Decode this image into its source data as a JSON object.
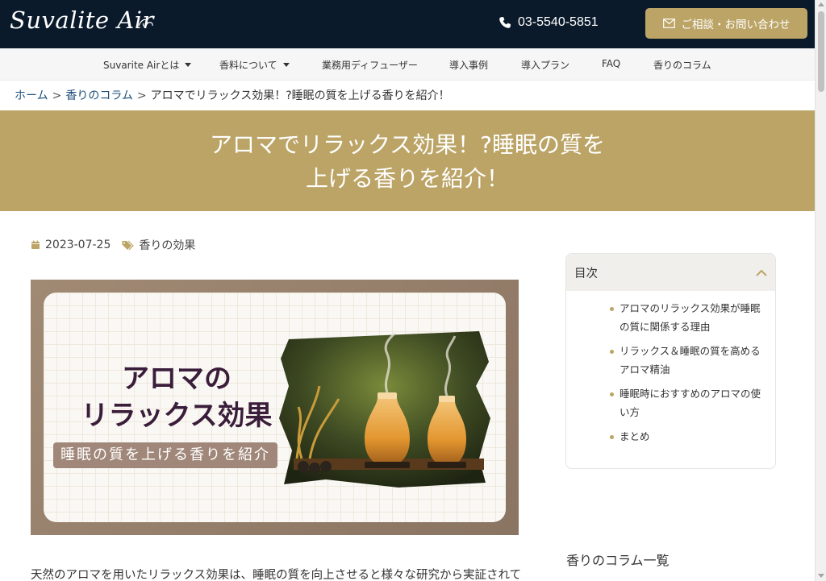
{
  "header": {
    "logo_text": "Suvalite Air",
    "phone": "03-5540-5851",
    "contact_label": "ご相談・お問い合わせ"
  },
  "nav": {
    "items": [
      {
        "label": "Suvarite Airとは",
        "dropdown": true
      },
      {
        "label": "香料について",
        "dropdown": true
      },
      {
        "label": "業務用ディフューザー",
        "dropdown": false
      },
      {
        "label": "導入事例",
        "dropdown": false
      },
      {
        "label": "導入プラン",
        "dropdown": false
      },
      {
        "label": "FAQ",
        "dropdown": false
      },
      {
        "label": "香りのコラム",
        "dropdown": false
      }
    ]
  },
  "breadcrumb": {
    "home": "ホーム",
    "column": "香りのコラム",
    "separator": ">",
    "current": "アロマでリラックス効果！?睡眠の質を上げる香りを紹介！"
  },
  "article": {
    "title_line1": "アロマでリラックス効果！?睡眠の質を",
    "title_line2": "上げる香りを紹介！",
    "date": "2023-07-25",
    "category": "香りの効果",
    "hero_title": "アロマの\nリラックス効果",
    "hero_subtitle": "睡眠の質を上げる香りを紹介",
    "lead": "天然のアロマを用いたリラックス効果は、睡眠の質を向上させると様々な研究から実証されて"
  },
  "toc": {
    "title": "目次",
    "items": [
      "アロマのリラックス効果が睡眠の質に関係する理由",
      "リラックス＆睡眠の質を高めるアロマ精油",
      "睡眠時におすすめのアロマの使い方",
      "まとめ"
    ]
  },
  "sidebar": {
    "column_list_heading": "香りのコラム一覧"
  },
  "colors": {
    "header_bg": "#0b1a2b",
    "accent_gold": "#bba466",
    "link_blue": "#1e4f7a"
  }
}
